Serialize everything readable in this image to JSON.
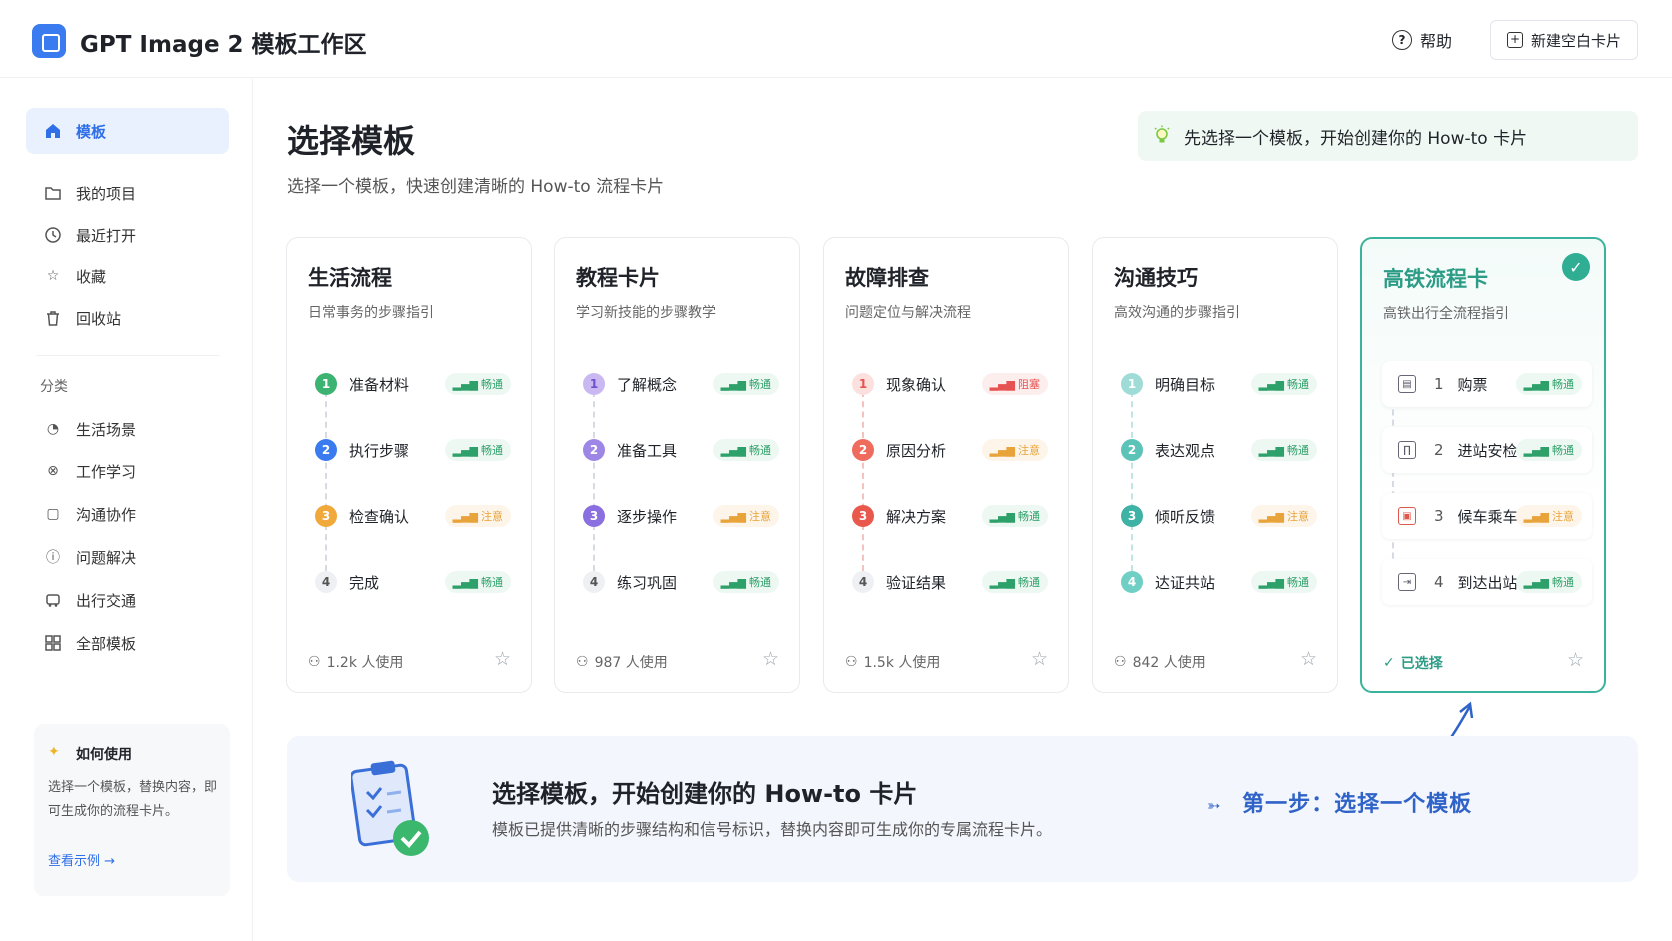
{
  "header": {
    "app_title": "GPT Image 2 模板工作区",
    "help_label": "帮助",
    "new_card_label": "新建空白卡片"
  },
  "sidebar": {
    "items": [
      {
        "label": "模板",
        "icon": "home-icon",
        "active": true
      },
      {
        "label": "我的项目",
        "icon": "folder-icon"
      },
      {
        "label": "最近打开",
        "icon": "clock-icon"
      },
      {
        "label": "收藏",
        "icon": "star-icon"
      },
      {
        "label": "回收站",
        "icon": "trash-icon"
      }
    ],
    "section_label": "分类",
    "categories": [
      {
        "label": "生活场景",
        "icon": "life-icon"
      },
      {
        "label": "工作学习",
        "icon": "work-icon"
      },
      {
        "label": "沟通协作",
        "icon": "chat-icon"
      },
      {
        "label": "问题解决",
        "icon": "problem-icon"
      },
      {
        "label": "出行交通",
        "icon": "car-icon"
      },
      {
        "label": "全部模板",
        "icon": "grid-icon"
      }
    ],
    "howto": {
      "title": "如何使用",
      "text": "选择一个模板，替换内容，即可生成你的流程卡片。",
      "link": "查看示例 →"
    }
  },
  "main": {
    "title": "选择模板",
    "subtitle": "选择一个模板，快速创建清晰的 How-to 流程卡片",
    "tip": "先选择一个模板，开始创建你的 How-to 卡片"
  },
  "cards": [
    {
      "title": "生活流程",
      "desc": "日常事务的步骤指引",
      "usage": "1.2k 人使用",
      "steps": [
        {
          "num": "1",
          "label": "准备材料",
          "signal": "畅通",
          "status": "ok",
          "color": "#3cb371"
        },
        {
          "num": "2",
          "label": "执行步骤",
          "signal": "畅通",
          "status": "ok",
          "color": "#3a7bf0"
        },
        {
          "num": "3",
          "label": "检查确认",
          "signal": "注意",
          "status": "warn",
          "color": "#f0a93a"
        },
        {
          "num": "4",
          "label": "完成",
          "signal": "畅通",
          "status": "ok",
          "color": "#b0b6bf"
        }
      ]
    },
    {
      "title": "教程卡片",
      "desc": "学习新技能的步骤教学",
      "usage": "987 人使用",
      "steps": [
        {
          "num": "1",
          "label": "了解概念",
          "signal": "畅通",
          "status": "ok",
          "color": "#c9b8f2"
        },
        {
          "num": "2",
          "label": "准备工具",
          "signal": "畅通",
          "status": "ok",
          "color": "#9d86e6"
        },
        {
          "num": "3",
          "label": "逐步操作",
          "signal": "注意",
          "status": "warn",
          "color": "#8a6fe0"
        },
        {
          "num": "4",
          "label": "练习巩固",
          "signal": "畅通",
          "status": "ok",
          "color": "#b0b6bf"
        }
      ]
    },
    {
      "title": "故障排查",
      "desc": "问题定位与解决流程",
      "usage": "1.5k 人使用",
      "steps": [
        {
          "num": "1",
          "label": "现象确认",
          "signal": "阻塞",
          "status": "bad",
          "color": "#f4b3b0"
        },
        {
          "num": "2",
          "label": "原因分析",
          "signal": "注意",
          "status": "warn",
          "color": "#ef6b5e"
        },
        {
          "num": "3",
          "label": "解决方案",
          "signal": "畅通",
          "status": "ok",
          "color": "#e9584c"
        },
        {
          "num": "4",
          "label": "验证结果",
          "signal": "畅通",
          "status": "ok",
          "color": "#b0b6bf"
        }
      ]
    },
    {
      "title": "沟通技巧",
      "desc": "高效沟通的步骤指引",
      "usage": "842 人使用",
      "steps": [
        {
          "num": "1",
          "label": "明确目标",
          "signal": "畅通",
          "status": "ok",
          "color": "#9fdcd7"
        },
        {
          "num": "2",
          "label": "表达观点",
          "signal": "畅通",
          "status": "ok",
          "color": "#5cc3b8"
        },
        {
          "num": "3",
          "label": "倾听反馈",
          "signal": "注意",
          "status": "warn",
          "color": "#3fb2a6"
        },
        {
          "num": "4",
          "label": "达证共站",
          "signal": "畅通",
          "status": "ok",
          "color": "#6fcfc4"
        }
      ]
    },
    {
      "title": "高铁流程卡",
      "desc": "高铁出行全流程指引",
      "selected_label": "已选择",
      "steps": [
        {
          "num": "1",
          "label": "购票",
          "signal": "畅通",
          "status": "ok",
          "icon": "ticket-icon"
        },
        {
          "num": "2",
          "label": "进站安检",
          "signal": "畅通",
          "status": "ok",
          "icon": "gate-icon"
        },
        {
          "num": "3",
          "label": "候车乘车",
          "signal": "注意",
          "status": "warn",
          "icon": "train-icon"
        },
        {
          "num": "4",
          "label": "到达出站",
          "signal": "畅通",
          "status": "ok",
          "icon": "exit-icon"
        }
      ]
    }
  ],
  "banner": {
    "title": "选择模板，开始创建你的 How-to 卡片",
    "text": "模板已提供清晰的步骤结构和信号标识，替换内容即可生成你的专属流程卡片。",
    "hint": "第一步：选择一个模板"
  },
  "colors": {
    "accent": "#2f6fe8",
    "selected": "#2fae93",
    "ok": "#2ea06a",
    "warn": "#e8a33a",
    "bad": "#e55451"
  }
}
